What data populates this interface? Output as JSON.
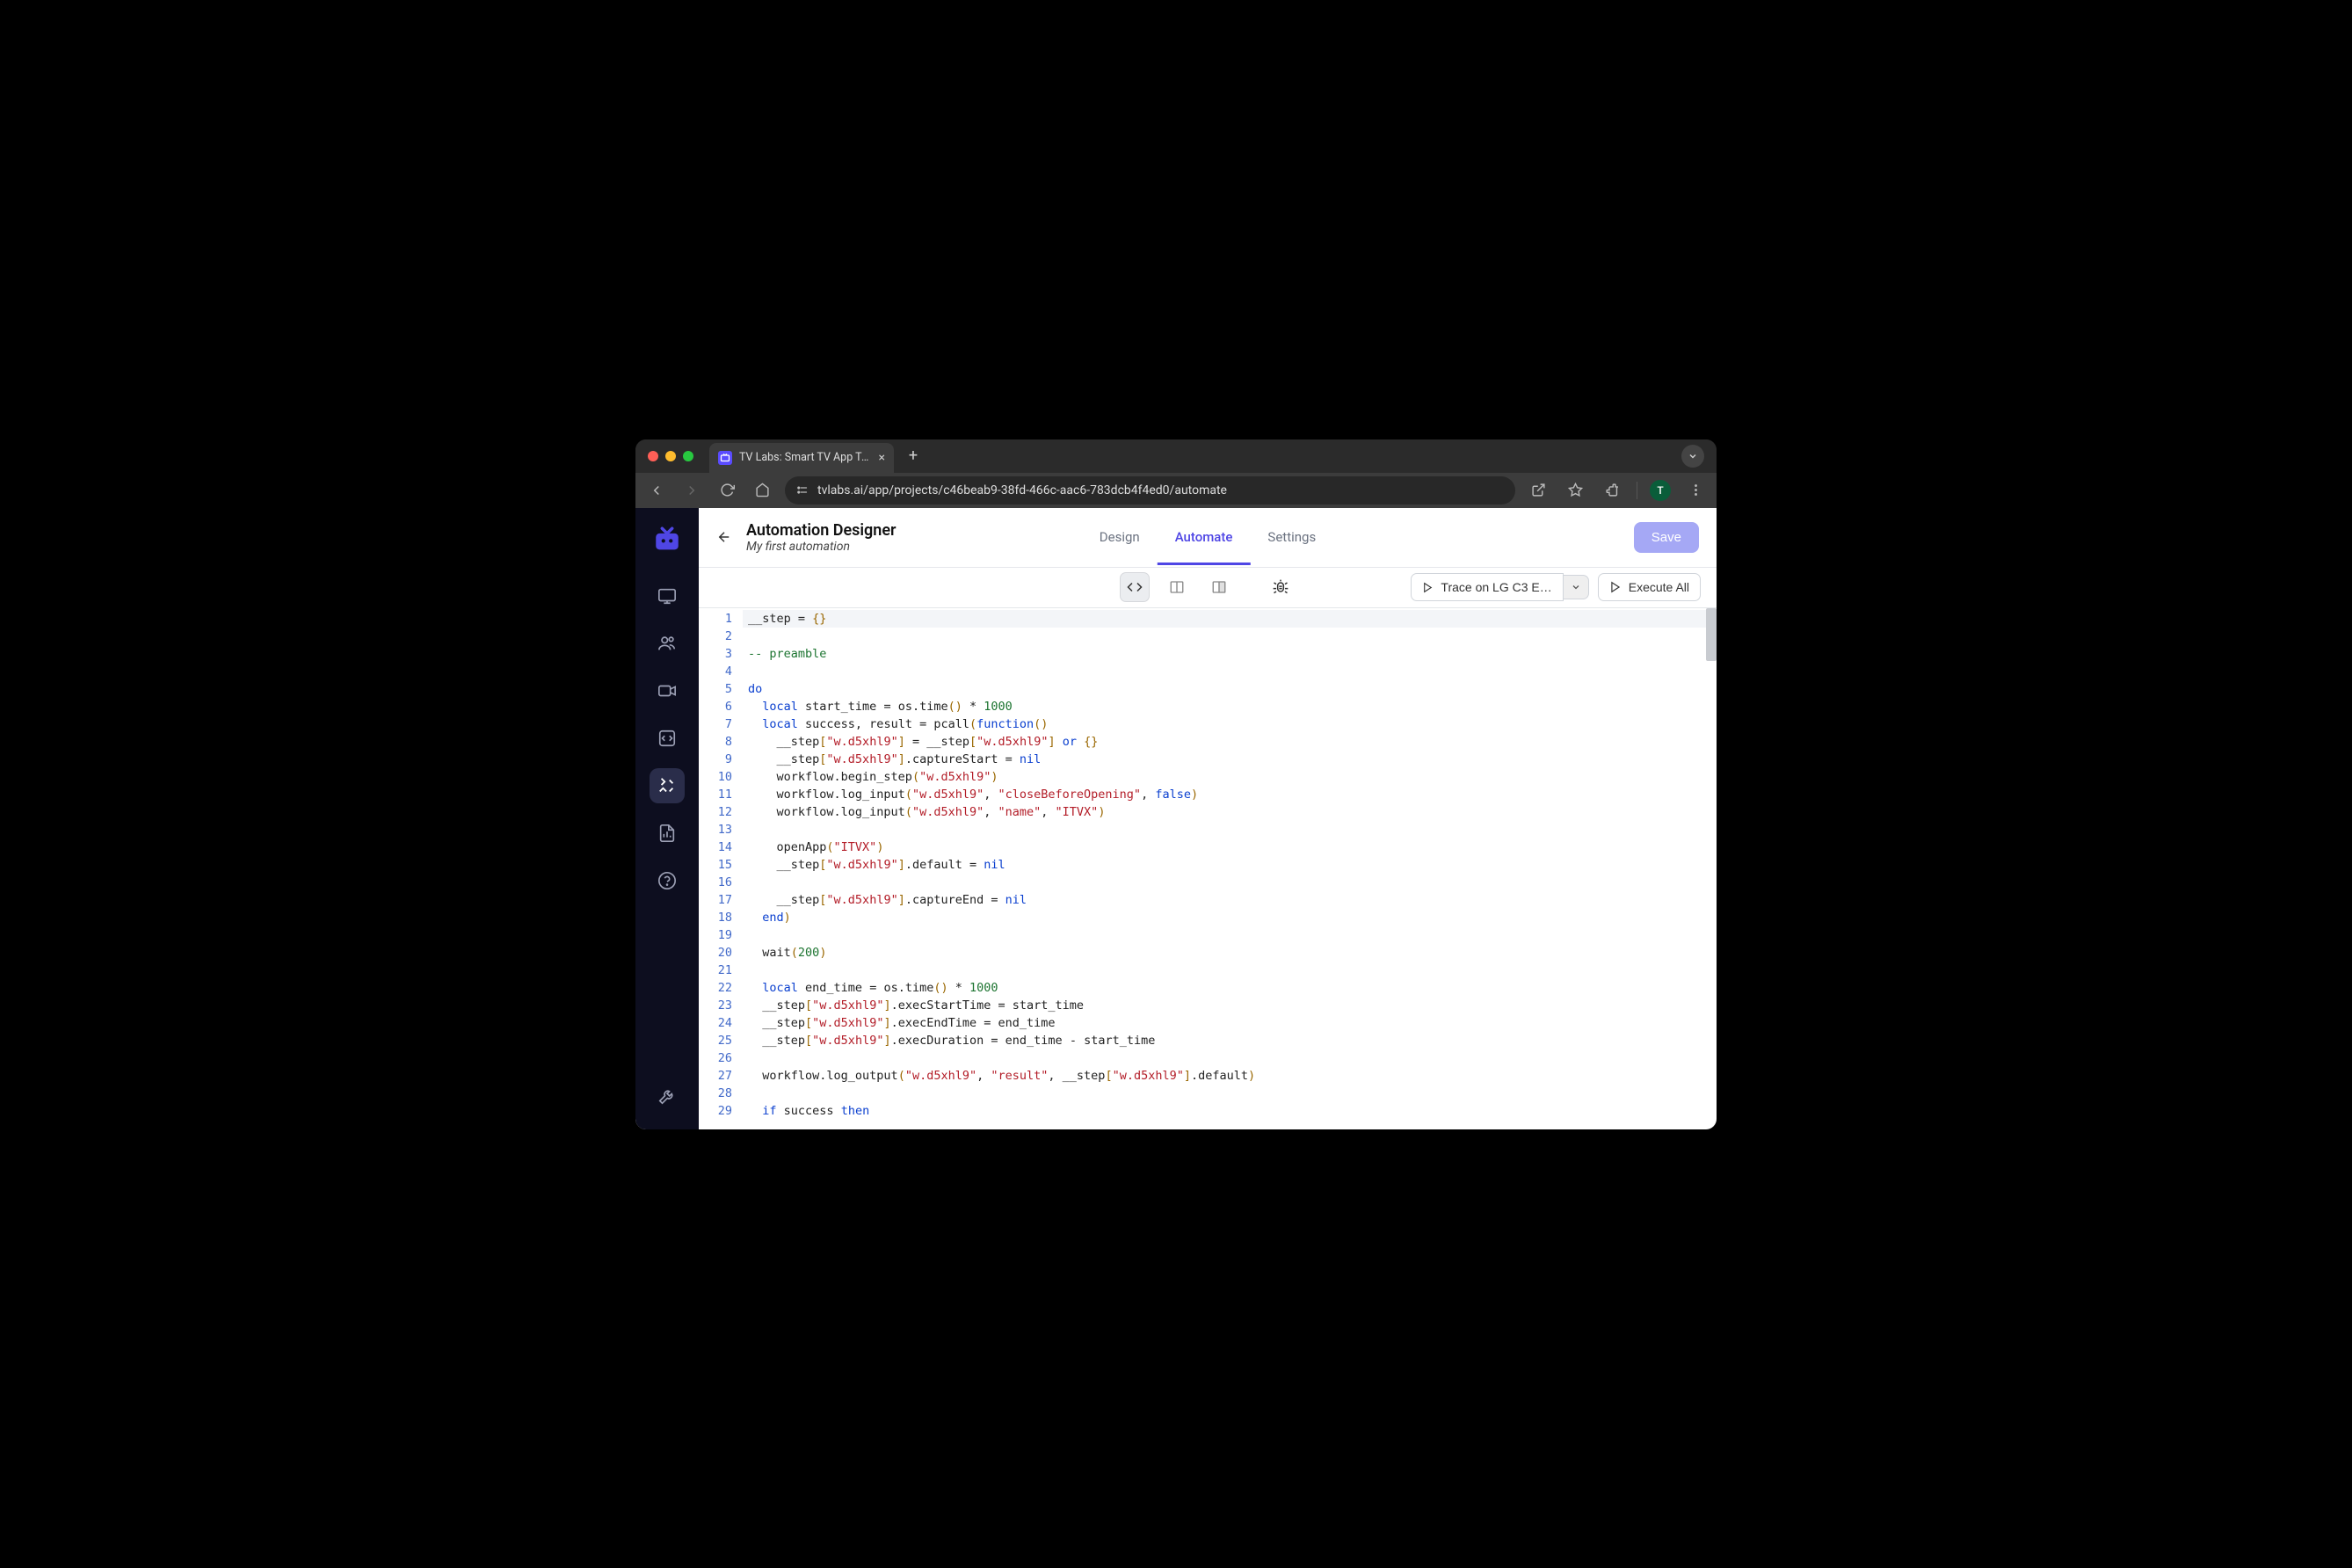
{
  "browser": {
    "tab_title": "TV Labs: Smart TV App Testi…",
    "url": "tvlabs.ai/app/projects/c46beab9-38fd-466c-aac6-783dcb4f4ed0/automate",
    "avatar_letter": "T"
  },
  "header": {
    "title": "Automation Designer",
    "subtitle": "My first automation",
    "tabs": {
      "design": "Design",
      "automate": "Automate",
      "settings": "Settings"
    },
    "save_label": "Save"
  },
  "toolbar": {
    "trace_label": "Trace on LG C3 E…",
    "execute_label": "Execute All"
  },
  "code_lines": [
    {
      "n": 1,
      "hl": true,
      "tokens": [
        [
          "fn",
          "__step "
        ],
        [
          "op",
          "= "
        ],
        [
          "brk",
          "{}"
        ]
      ]
    },
    {
      "n": 2,
      "tokens": []
    },
    {
      "n": 3,
      "tokens": [
        [
          "cmt",
          "-- preamble"
        ]
      ]
    },
    {
      "n": 4,
      "tokens": []
    },
    {
      "n": 5,
      "tokens": [
        [
          "kw",
          "do"
        ]
      ]
    },
    {
      "n": 6,
      "tokens": [
        [
          "fn",
          "  "
        ],
        [
          "kw",
          "local"
        ],
        [
          "fn",
          " start_time "
        ],
        [
          "op",
          "= "
        ],
        [
          "fn",
          "os.time"
        ],
        [
          "brk",
          "()"
        ],
        [
          "fn",
          " "
        ],
        [
          "op",
          "* "
        ],
        [
          "num",
          "1000"
        ]
      ]
    },
    {
      "n": 7,
      "tokens": [
        [
          "fn",
          "  "
        ],
        [
          "kw",
          "local"
        ],
        [
          "fn",
          " success, result "
        ],
        [
          "op",
          "= "
        ],
        [
          "fn",
          "pcall"
        ],
        [
          "brk",
          "("
        ],
        [
          "kw",
          "function"
        ],
        [
          "brk",
          "()"
        ]
      ]
    },
    {
      "n": 8,
      "tokens": [
        [
          "fn",
          "    __step"
        ],
        [
          "brk",
          "["
        ],
        [
          "str",
          "\"w.d5xhl9\""
        ],
        [
          "brk",
          "]"
        ],
        [
          "fn",
          " "
        ],
        [
          "op",
          "= "
        ],
        [
          "fn",
          "__step"
        ],
        [
          "brk",
          "["
        ],
        [
          "str",
          "\"w.d5xhl9\""
        ],
        [
          "brk",
          "]"
        ],
        [
          "fn",
          " "
        ],
        [
          "kw",
          "or"
        ],
        [
          "fn",
          " "
        ],
        [
          "brk",
          "{}"
        ]
      ]
    },
    {
      "n": 9,
      "tokens": [
        [
          "fn",
          "    __step"
        ],
        [
          "brk",
          "["
        ],
        [
          "str",
          "\"w.d5xhl9\""
        ],
        [
          "brk",
          "]"
        ],
        [
          "fn",
          ".captureStart "
        ],
        [
          "op",
          "= "
        ],
        [
          "nil",
          "nil"
        ]
      ]
    },
    {
      "n": 10,
      "tokens": [
        [
          "fn",
          "    workflow.begin_step"
        ],
        [
          "brk",
          "("
        ],
        [
          "str",
          "\"w.d5xhl9\""
        ],
        [
          "brk",
          ")"
        ]
      ]
    },
    {
      "n": 11,
      "tokens": [
        [
          "fn",
          "    workflow.log_input"
        ],
        [
          "brk",
          "("
        ],
        [
          "str",
          "\"w.d5xhl9\""
        ],
        [
          "fn",
          ", "
        ],
        [
          "str",
          "\"closeBeforeOpening\""
        ],
        [
          "fn",
          ", "
        ],
        [
          "bool",
          "false"
        ],
        [
          "brk",
          ")"
        ]
      ]
    },
    {
      "n": 12,
      "tokens": [
        [
          "fn",
          "    workflow.log_input"
        ],
        [
          "brk",
          "("
        ],
        [
          "str",
          "\"w.d5xhl9\""
        ],
        [
          "fn",
          ", "
        ],
        [
          "str",
          "\"name\""
        ],
        [
          "fn",
          ", "
        ],
        [
          "str",
          "\"ITVX\""
        ],
        [
          "brk",
          ")"
        ]
      ]
    },
    {
      "n": 13,
      "tokens": []
    },
    {
      "n": 14,
      "tokens": [
        [
          "fn",
          "    openApp"
        ],
        [
          "brk",
          "("
        ],
        [
          "str",
          "\"ITVX\""
        ],
        [
          "brk",
          ")"
        ]
      ]
    },
    {
      "n": 15,
      "tokens": [
        [
          "fn",
          "    __step"
        ],
        [
          "brk",
          "["
        ],
        [
          "str",
          "\"w.d5xhl9\""
        ],
        [
          "brk",
          "]"
        ],
        [
          "fn",
          ".default "
        ],
        [
          "op",
          "= "
        ],
        [
          "nil",
          "nil"
        ]
      ]
    },
    {
      "n": 16,
      "tokens": []
    },
    {
      "n": 17,
      "tokens": [
        [
          "fn",
          "    __step"
        ],
        [
          "brk",
          "["
        ],
        [
          "str",
          "\"w.d5xhl9\""
        ],
        [
          "brk",
          "]"
        ],
        [
          "fn",
          ".captureEnd "
        ],
        [
          "op",
          "= "
        ],
        [
          "nil",
          "nil"
        ]
      ]
    },
    {
      "n": 18,
      "tokens": [
        [
          "fn",
          "  "
        ],
        [
          "kw",
          "end"
        ],
        [
          "brk",
          ")"
        ]
      ]
    },
    {
      "n": 19,
      "tokens": []
    },
    {
      "n": 20,
      "tokens": [
        [
          "fn",
          "  wait"
        ],
        [
          "brk",
          "("
        ],
        [
          "num",
          "200"
        ],
        [
          "brk",
          ")"
        ]
      ]
    },
    {
      "n": 21,
      "tokens": []
    },
    {
      "n": 22,
      "tokens": [
        [
          "fn",
          "  "
        ],
        [
          "kw",
          "local"
        ],
        [
          "fn",
          " end_time "
        ],
        [
          "op",
          "= "
        ],
        [
          "fn",
          "os.time"
        ],
        [
          "brk",
          "()"
        ],
        [
          "fn",
          " "
        ],
        [
          "op",
          "* "
        ],
        [
          "num",
          "1000"
        ]
      ]
    },
    {
      "n": 23,
      "tokens": [
        [
          "fn",
          "  __step"
        ],
        [
          "brk",
          "["
        ],
        [
          "str",
          "\"w.d5xhl9\""
        ],
        [
          "brk",
          "]"
        ],
        [
          "fn",
          ".execStartTime "
        ],
        [
          "op",
          "= "
        ],
        [
          "fn",
          "start_time"
        ]
      ]
    },
    {
      "n": 24,
      "tokens": [
        [
          "fn",
          "  __step"
        ],
        [
          "brk",
          "["
        ],
        [
          "str",
          "\"w.d5xhl9\""
        ],
        [
          "brk",
          "]"
        ],
        [
          "fn",
          ".execEndTime "
        ],
        [
          "op",
          "= "
        ],
        [
          "fn",
          "end_time"
        ]
      ]
    },
    {
      "n": 25,
      "tokens": [
        [
          "fn",
          "  __step"
        ],
        [
          "brk",
          "["
        ],
        [
          "str",
          "\"w.d5xhl9\""
        ],
        [
          "brk",
          "]"
        ],
        [
          "fn",
          ".execDuration "
        ],
        [
          "op",
          "= "
        ],
        [
          "fn",
          "end_time "
        ],
        [
          "op",
          "- "
        ],
        [
          "fn",
          "start_time"
        ]
      ]
    },
    {
      "n": 26,
      "tokens": []
    },
    {
      "n": 27,
      "tokens": [
        [
          "fn",
          "  workflow.log_output"
        ],
        [
          "brk",
          "("
        ],
        [
          "str",
          "\"w.d5xhl9\""
        ],
        [
          "fn",
          ", "
        ],
        [
          "str",
          "\"result\""
        ],
        [
          "fn",
          ", __step"
        ],
        [
          "brk",
          "["
        ],
        [
          "str",
          "\"w.d5xhl9\""
        ],
        [
          "brk",
          "]"
        ],
        [
          "fn",
          ".default"
        ],
        [
          "brk",
          ")"
        ]
      ]
    },
    {
      "n": 28,
      "tokens": []
    },
    {
      "n": 29,
      "tokens": [
        [
          "fn",
          "  "
        ],
        [
          "kw",
          "if"
        ],
        [
          "fn",
          " success "
        ],
        [
          "kw",
          "then"
        ]
      ]
    }
  ]
}
